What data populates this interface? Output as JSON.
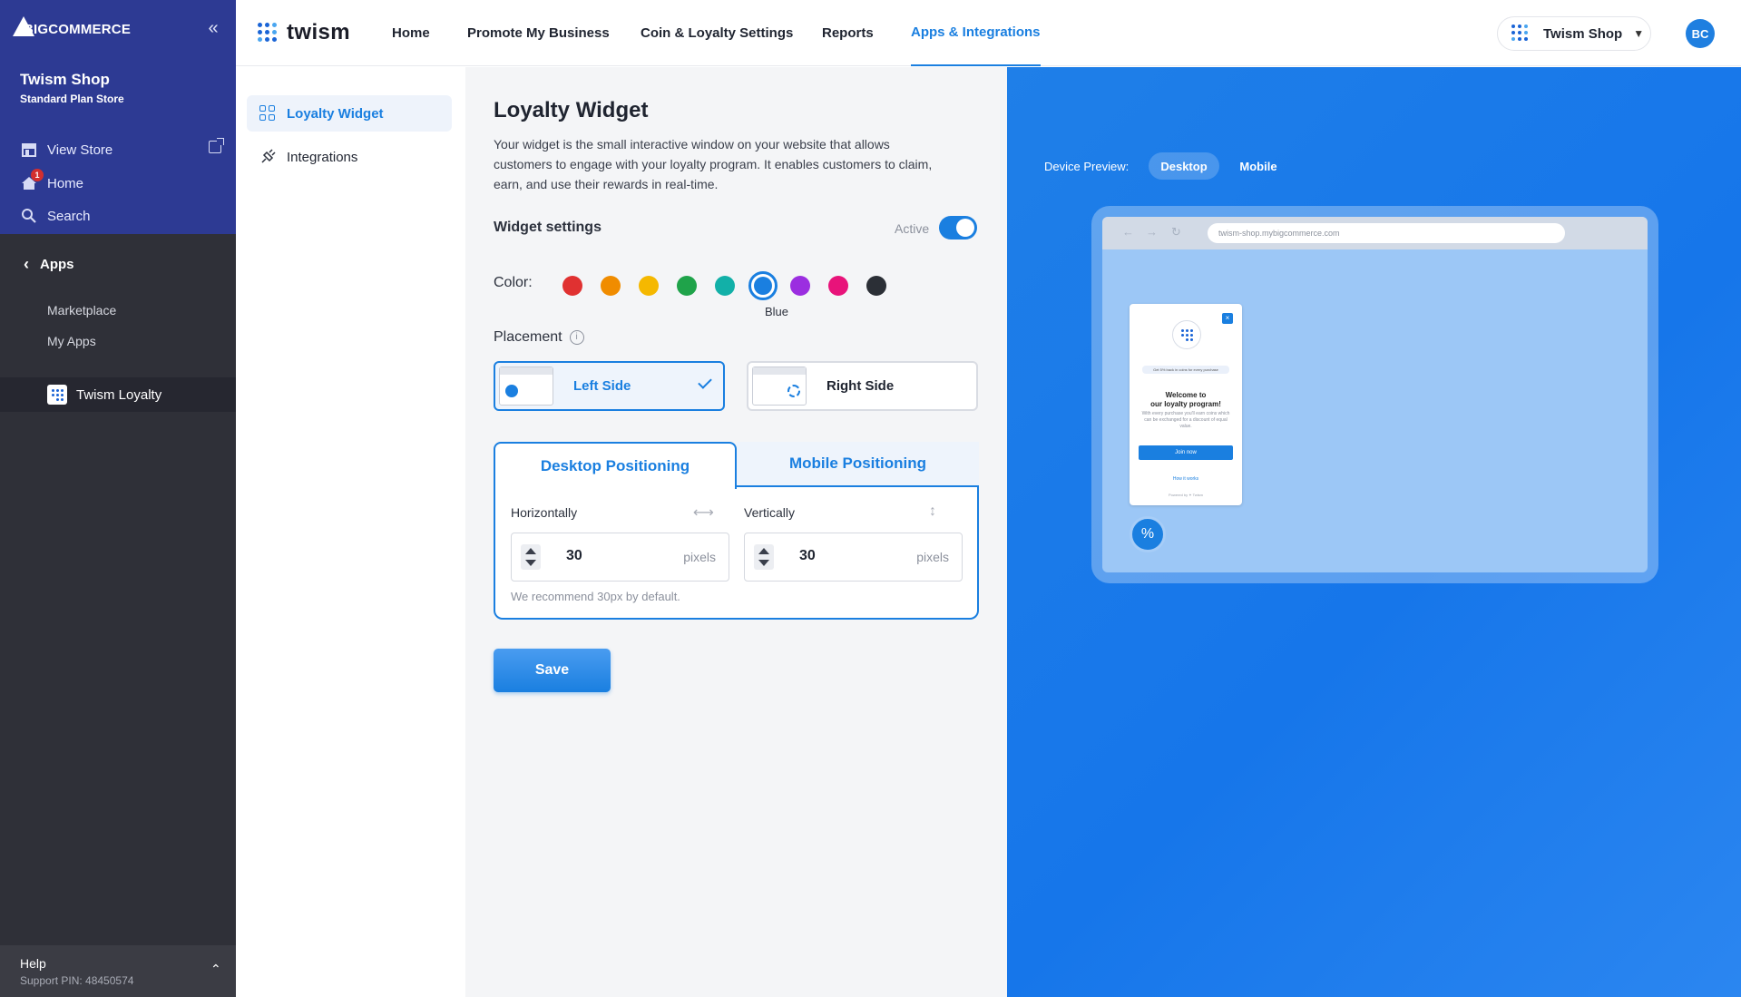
{
  "sidebar": {
    "logo": "BIGCOMMERCE",
    "store_name": "Twism Shop",
    "plan": "Standard Plan Store",
    "nav": [
      {
        "label": "View Store"
      },
      {
        "label": "Home",
        "badge": "1"
      },
      {
        "label": "Search"
      }
    ],
    "section": "Apps",
    "sub_items": [
      {
        "label": "Marketplace"
      },
      {
        "label": "My Apps"
      }
    ],
    "active_app": "Twism Loyalty",
    "help": {
      "title": "Help",
      "pin": "Support PIN: 48450574"
    }
  },
  "topbar": {
    "brand": "twism",
    "tabs": [
      {
        "label": "Home"
      },
      {
        "label": "Promote My Business"
      },
      {
        "label": "Coin & Loyalty Settings"
      },
      {
        "label": "Reports"
      },
      {
        "label": "Apps & Integrations",
        "active": true
      }
    ],
    "shop_switch": "Twism Shop",
    "avatar": "BC"
  },
  "appnav": [
    {
      "label": "Loyalty Widget",
      "active": true
    },
    {
      "label": "Integrations"
    }
  ],
  "widget": {
    "title": "Loyalty Widget",
    "description": "Your widget is the small interactive window on your website that allows customers to engage with your loyalty program. It enables customers to claim, earn, and use their rewards in real-time.",
    "settings_label": "Widget settings",
    "active_label": "Active",
    "active": true,
    "color_label": "Color:",
    "colors": [
      "#e03131",
      "#f08c00",
      "#f5b800",
      "#1fa34a",
      "#12b0a8",
      "#1a7fe0",
      "#9b2ee0",
      "#e8137a",
      "#2b2f36"
    ],
    "selected_color": "Blue",
    "accent": "#1a7fe0",
    "placement_label": "Placement",
    "placement_options": [
      {
        "label": "Left Side",
        "selected": true
      },
      {
        "label": "Right Side",
        "selected": false
      }
    ],
    "positioning_tabs": [
      {
        "label": "Desktop Positioning",
        "active": true
      },
      {
        "label": "Mobile Positioning",
        "active": false
      }
    ],
    "horizontal": {
      "label": "Horizontally",
      "value": "30",
      "unit": "pixels"
    },
    "vertical": {
      "label": "Vertically",
      "value": "30",
      "unit": "pixels"
    },
    "recommend": "We recommend 30px by default.",
    "save_label": "Save"
  },
  "preview": {
    "label": "Device Preview:",
    "options": [
      "Desktop",
      "Mobile"
    ],
    "selected": "Desktop",
    "url": "twism-shop.mybigcommerce.com",
    "card": {
      "pill": "Get 5% back in coins for every purchase",
      "heading_line1": "Welcome to",
      "heading_line2": "our loyalty program!",
      "text": "With every purchase you'll earn coins which can be exchanged for a discount of equal value.",
      "join": "Join now",
      "how": "How it works",
      "powered": "Powered by ✦ Twism"
    }
  }
}
